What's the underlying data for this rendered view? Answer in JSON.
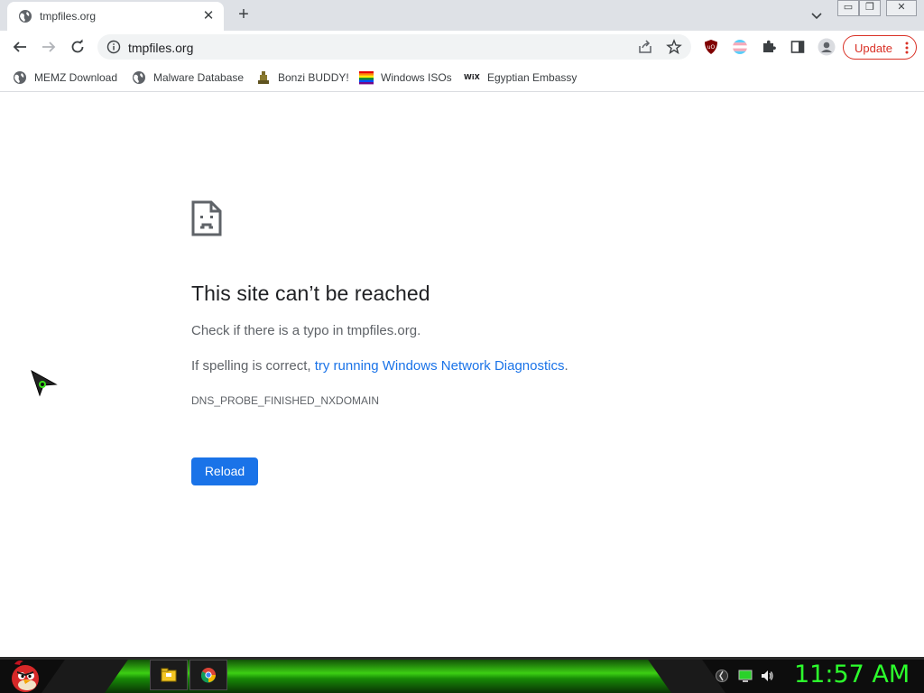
{
  "browser": {
    "tab": {
      "title": "tmpfiles.org",
      "close_glyph": "✕",
      "favicon": "globe-icon"
    },
    "new_tab_glyph": "+",
    "window_controls": {
      "minimize": "▭",
      "maximize": "❐",
      "close": "✕"
    },
    "address_bar": {
      "url": "tmpfiles.org",
      "icon": "info-icon"
    },
    "extensions": [
      "ublock-origin-icon",
      "trans-flag-icon",
      "puzzle-extensions-icon",
      "side-panel-icon",
      "profile-avatar-icon"
    ],
    "update_button": {
      "label": "Update"
    },
    "accent_color": "#1a73e8",
    "update_color": "#d93025"
  },
  "bookmarks": [
    {
      "label": "MEMZ Download",
      "icon": "globe-icon"
    },
    {
      "label": "Malware Database",
      "icon": "globe-icon"
    },
    {
      "label": "Bonzi BUDDY!",
      "icon": "bonzi-icon"
    },
    {
      "label": "Windows ISOs",
      "icon": "windows-flag-icon"
    },
    {
      "label": "Egyptian Embassy",
      "icon": "wix-icon",
      "icon_text": "WiX"
    }
  ],
  "error_page": {
    "title": "This site can’t be reached",
    "line1": "Check if there is a typo in tmpfiles.org.",
    "line2_prefix": "If spelling is correct, ",
    "line2_link": "try running Windows Network Diagnostics",
    "line2_suffix": ".",
    "error_code": "DNS_PROBE_FINISHED_NXDOMAIN",
    "reload_label": "Reload"
  },
  "taskbar": {
    "start_icon": "angry-bird-icon",
    "tasks": [
      "file-explorer-icon",
      "chrome-icon"
    ],
    "tray": [
      "network-icon",
      "monitor-icon",
      "volume-icon"
    ],
    "clock": "11:57 AM",
    "clock_color": "#2cff2c"
  }
}
